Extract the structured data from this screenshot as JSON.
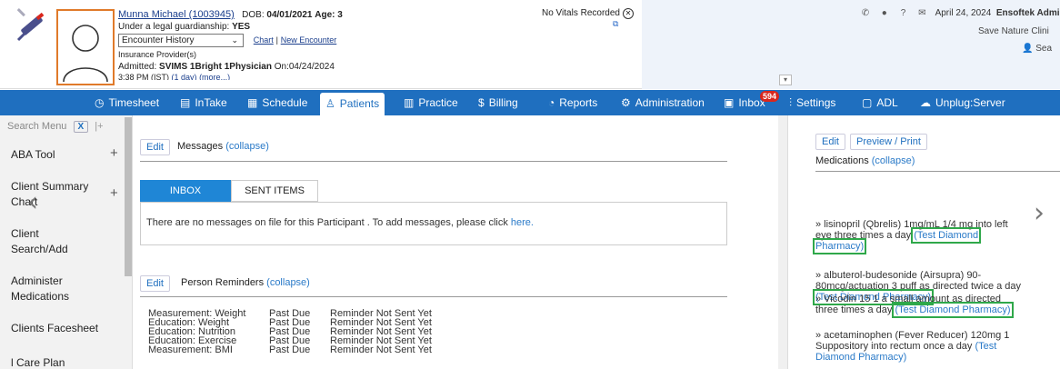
{
  "patient": {
    "name": "Munna Michael (1003945)",
    "dob_label": "DOB:",
    "dob": "04/01/2021",
    "age_label": "Age:",
    "age": "3",
    "guardianship_label": "Under a legal guardianship:",
    "guardianship": "YES",
    "encounter_select": "Encounter History",
    "chart_link": "Chart",
    "new_encounter_link": "New Encounter",
    "insurance_label": "Insurance Provider(s)",
    "admitted_label": "Admitted:",
    "admitted": "SVIMS 1Bright 1Physician",
    "admitted_on_label": "On:",
    "admitted_on": "04/24/2024",
    "admitted_time": "3:38 PM (IST)",
    "admitted_duration": "(1 day)",
    "more_link": "(more...)"
  },
  "vitals": {
    "text": "No Vitals Recorded"
  },
  "topbar": {
    "date": "April 24, 2024",
    "user": "Ensoftek Admin",
    "clinic": "Save Nature Clini",
    "search": "Sea"
  },
  "nav": {
    "items": [
      {
        "label": "Timesheet",
        "icon": "clock-plus-icon"
      },
      {
        "label": "InTake",
        "icon": "intake-icon"
      },
      {
        "label": "Schedule",
        "icon": "calendar-icon"
      },
      {
        "label": "Patients",
        "icon": "user-icon"
      },
      {
        "label": "Practice",
        "icon": "building-icon"
      },
      {
        "label": "Billing",
        "icon": "dollar-icon"
      },
      {
        "label": "Reports",
        "icon": "pie-chart-icon"
      },
      {
        "label": "Administration",
        "icon": "gear-icon"
      },
      {
        "label": "Inbox",
        "icon": "inbox-icon"
      },
      {
        "label": "Settings",
        "icon": "sliders-icon"
      },
      {
        "label": "ADL",
        "icon": "adl-icon"
      },
      {
        "label": "Unplug:Server",
        "icon": "cloud-icon"
      }
    ],
    "inbox_badge": "594"
  },
  "sidebar": {
    "search_placeholder": "Search Menu",
    "clear_label": "X",
    "pin_label": "|+",
    "items": [
      {
        "line1": "ABA Tool",
        "line2": ""
      },
      {
        "line1": "Client Summary",
        "line2": "Chart"
      },
      {
        "line1": "Client",
        "line2": "Search/Add"
      },
      {
        "line1": "Administer",
        "line2": "Medications"
      },
      {
        "line1": "Clients Facesheet",
        "line2": ""
      },
      {
        "line1": "l Care Plan",
        "line2": ""
      }
    ]
  },
  "messages": {
    "edit_label": "Edit",
    "title": "Messages",
    "collapse_label": "(collapse)",
    "tab_inbox": "INBOX",
    "tab_sent": "SENT ITEMS",
    "empty_text": "There are no messages on file for this Participant . To add messages, please click",
    "here_link": "here."
  },
  "reminders": {
    "edit_label": "Edit",
    "title": "Person Reminders",
    "collapse_label": "(collapse)",
    "rows": [
      {
        "item": "Measurement: Weight",
        "status": "Past Due",
        "sent": "Reminder Not Sent Yet"
      },
      {
        "item": "Education: Weight",
        "status": "Past Due",
        "sent": "Reminder Not Sent Yet"
      },
      {
        "item": "Education: Nutrition",
        "status": "Past Due",
        "sent": "Reminder Not Sent Yet"
      },
      {
        "item": "Education: Exercise",
        "status": "Past Due",
        "sent": "Reminder Not Sent Yet"
      },
      {
        "item": "Measurement: BMI",
        "status": "Past Due",
        "sent": "Reminder Not Sent Yet"
      }
    ]
  },
  "medications": {
    "edit_label": "Edit",
    "preview_label": "Preview / Print",
    "title": "Medications",
    "collapse_label": "(collapse)",
    "items": [
      {
        "text": "» lisinopril (Qbrelis) 1mg/mL 1/4 mg into left eye three times a day",
        "pharmacy": "(Test Diamond Pharmacy)"
      },
      {
        "text": "» albuterol-budesonide (Airsupra) 90-80mcg/actuation 3 puff as directed twice a day",
        "pharmacy": "(Test Diamond Pharmacy)"
      },
      {
        "text": "» Vicodin 15 1 a small amount as directed three times a day",
        "pharmacy": "(Test Diamond Pharmacy)"
      },
      {
        "text": "» acetaminophen (Fever Reducer) 120mg 1 Suppository into rectum once a day",
        "pharmacy": "(Test Diamond Pharmacy)"
      }
    ]
  },
  "colors": {
    "nav_bg": "#1f6fbf",
    "highlight_box": "#2fa84a",
    "badge": "#d9261c",
    "avatar_border": "#e07a2a"
  }
}
